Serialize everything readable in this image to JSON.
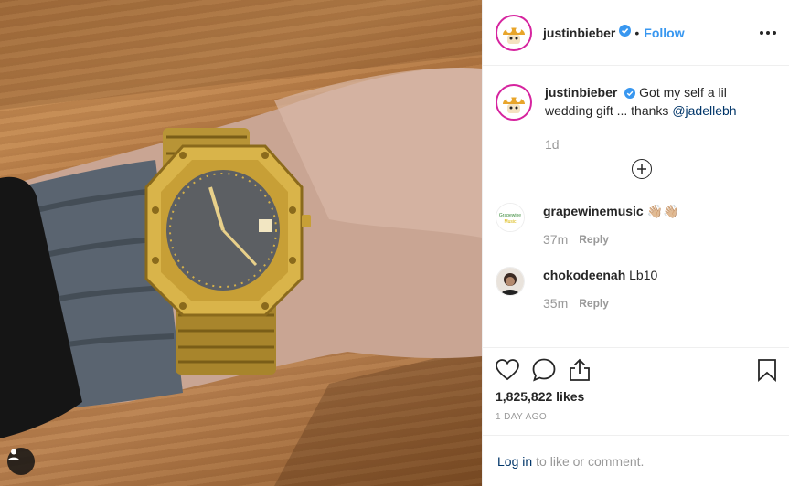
{
  "post": {
    "username": "justinbieber",
    "follow_label": "Follow",
    "separator": "•",
    "caption_text": "Got my self a lil wedding gift ... thanks",
    "caption_mention": "@jadellebh",
    "caption_time": "1d"
  },
  "comments": [
    {
      "username": "grapewinemusic",
      "text": "👋🏼👋🏼",
      "time": "37m",
      "reply_label": "Reply"
    },
    {
      "username": "chokodeenah",
      "text": "Lb10",
      "time": "35m",
      "reply_label": "Reply"
    }
  ],
  "stats": {
    "likes": "1,825,822 likes",
    "date": "1 DAY AGO"
  },
  "login": {
    "link": "Log in",
    "rest": "to like or comment."
  },
  "colors": {
    "accent": "#3897f0",
    "link": "#003569",
    "muted": "#999999",
    "border": "#efefef"
  },
  "icons": [
    "user-tag-icon",
    "verified-badge-icon",
    "more-options-icon",
    "load-more-comments-icon",
    "heart-icon",
    "comment-icon",
    "share-icon",
    "bookmark-icon"
  ]
}
